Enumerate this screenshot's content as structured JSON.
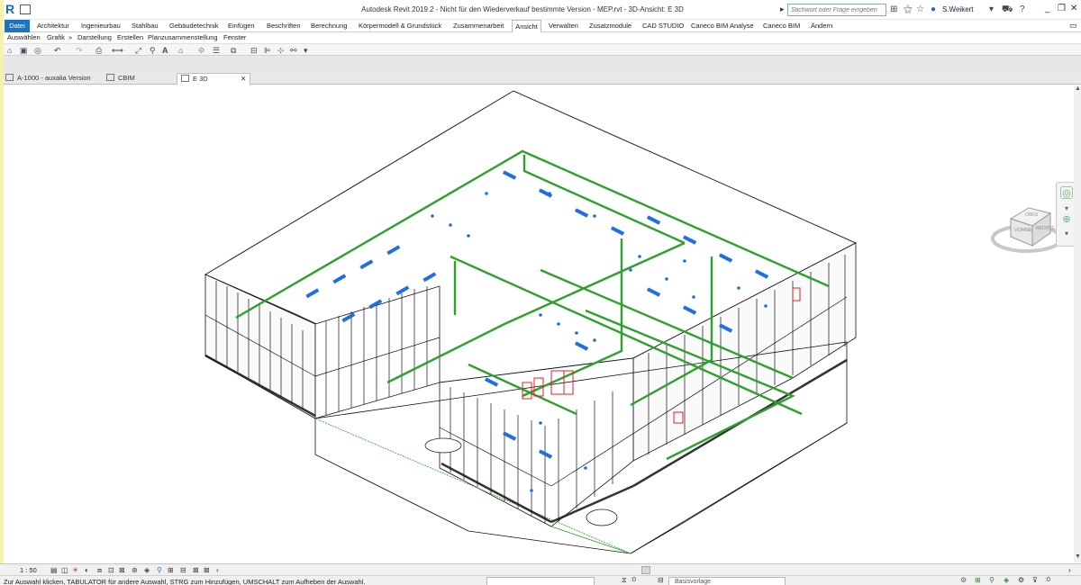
{
  "titlebar": {
    "logo": "R",
    "title": "Autodesk Revit 2019.2 - Nicht für den Wiederverkauf bestimmte Version - MEP.rvt - 3D-Ansicht: E 3D",
    "search_placeholder": "Stichwort oder Frage eingeben",
    "user": "S.Weikert"
  },
  "menu": {
    "items": [
      "Datei",
      "Architektur",
      "Ingenieurbau",
      "Stahlbau",
      "Gebäudetechnik",
      "Einfügen",
      "Beschriften",
      "Berechnung",
      "Körpermodell & Grundstück",
      "Zusammenarbeit",
      "Ansicht",
      "Verwalten",
      "Zusatzmodule",
      "CAD STUDIO",
      "Caneco BIM Analyse",
      "Caneco BIM",
      "Ändern"
    ]
  },
  "context": {
    "items": [
      "Auswählen",
      "Grafik",
      "»",
      "Darstellung",
      "Erstellen",
      "Planzusammenstellung",
      "Fenster"
    ]
  },
  "tabs": [
    {
      "label": "A-1000 - auxalia Version"
    },
    {
      "label": "CBIM"
    },
    {
      "label": "E 3D"
    }
  ],
  "viewcube": {
    "top": "OBEN",
    "front": "VORNE",
    "right": "RECHTS"
  },
  "viewcontrol": {
    "scale": "1 : 50"
  },
  "status": {
    "text": "Zur Auswahl klicken, TABULATOR für andere Auswahl, STRG zum Hinzufügen, UMSCHALT zum Aufheben der Auswahl.",
    "workset_value": ":0",
    "design_option": "Basisvorlage"
  },
  "colors": {
    "accent": "#1e73be",
    "duct_green": "#2ea02e",
    "fixture_blue": "#1f6fe0",
    "equipment_red": "#e02020"
  }
}
